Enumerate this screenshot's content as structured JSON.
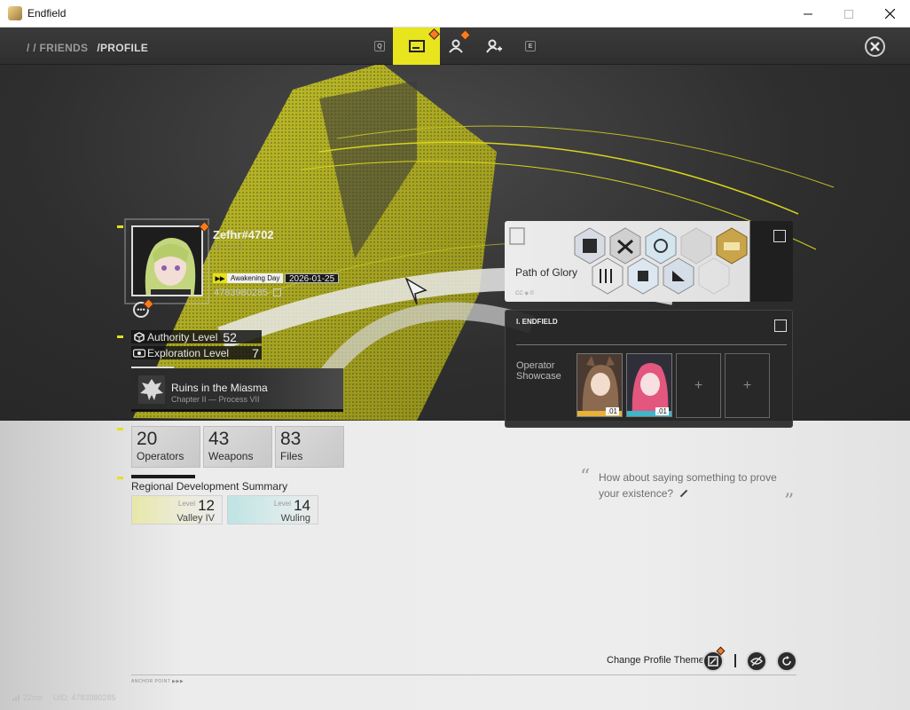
{
  "window": {
    "title": "Endfield"
  },
  "nav": {
    "breadcrumb_friends": "/ / FRIENDS",
    "breadcrumb_profile": "/PROFILE",
    "key_left": "Q",
    "key_right": "E"
  },
  "profile": {
    "name": "Zefhr#4702",
    "awakening_label": "Awakening Day",
    "awakening_date": "2026-01-25",
    "uid": "4783980285",
    "authority_label": "Authority Level",
    "authority_value": "52",
    "exploration_label": "Exploration Level",
    "exploration_value": "7"
  },
  "chapter": {
    "title": "Ruins in the Miasma",
    "subtitle": "Chapter II — Process VII"
  },
  "stats": [
    {
      "value": "20",
      "label": "Operators"
    },
    {
      "value": "43",
      "label": "Weapons"
    },
    {
      "value": "83",
      "label": "Files"
    }
  ],
  "regional": {
    "title": "Regional Development Summary",
    "level_label": "Level",
    "regions": [
      {
        "name": "Valley IV",
        "level": "12"
      },
      {
        "name": "Wuling",
        "level": "14"
      }
    ]
  },
  "glory": {
    "title": "Path of Glory"
  },
  "showcase": {
    "header": "I. ENDFIELD",
    "title": "Operator Showcase",
    "operators": [
      {
        "level": ".01"
      },
      {
        "level": ".01"
      }
    ],
    "empty_slot": "+"
  },
  "quote": {
    "text": "How about saying something to prove your existence?"
  },
  "footer": {
    "theme_label": "Change Profile Theme",
    "anchor": "ANCHOR POINT",
    "ping": "22ms",
    "uid": "UID: 4783980285"
  },
  "colors": {
    "accent_yellow": "#e8e41e",
    "notify_orange": "#ff7a1a"
  }
}
